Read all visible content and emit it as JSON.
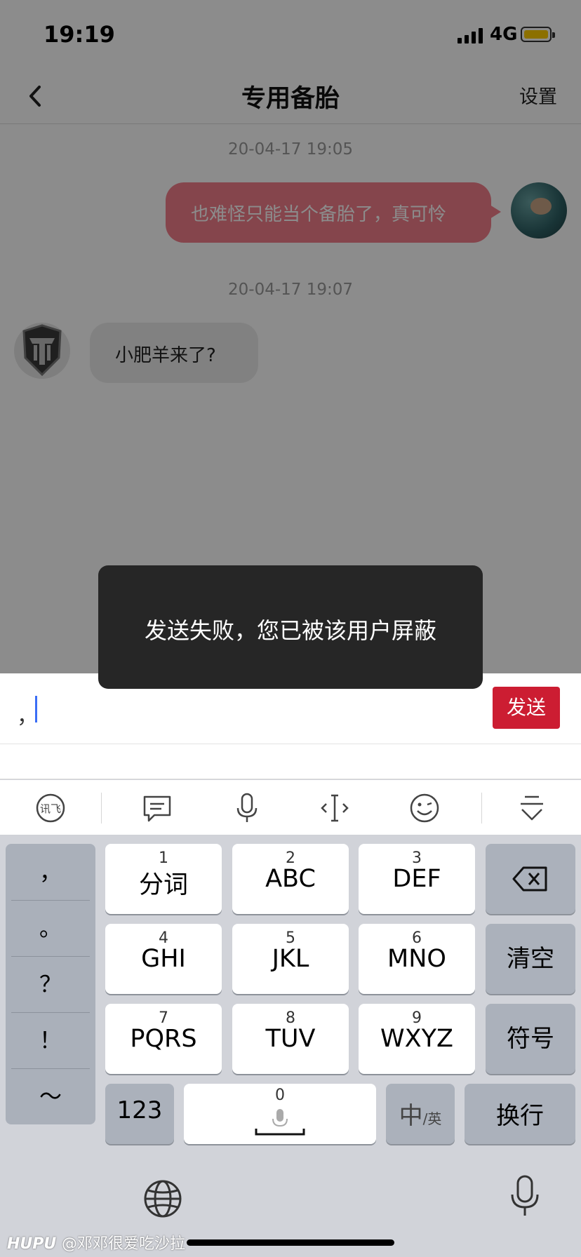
{
  "status_bar": {
    "time": "19:19",
    "network": "4G",
    "battery_color": "#ffcc00"
  },
  "nav": {
    "title": "专用备胎",
    "settings_label": "设置"
  },
  "messages": [
    {
      "timestamp": "20-04-17 19:05",
      "direction": "out",
      "text": "也难怪只能当个备胎了，真可怜"
    },
    {
      "timestamp": "20-04-17 19:07",
      "direction": "in",
      "text": "小肥羊来了?"
    }
  ],
  "toast": {
    "text": "发送失败，您已被该用户屏蔽"
  },
  "input": {
    "value": "，",
    "send_label": "发送",
    "send_color": "#cc1d32"
  },
  "toolbar": {
    "icons": [
      "ifly-logo-icon",
      "message-icon",
      "microphone-icon",
      "text-cursor-icon",
      "emoji-icon",
      "collapse-keyboard-icon"
    ],
    "ifly_text": "讯飞"
  },
  "keyboard": {
    "punctuation": [
      "，",
      "。",
      "？",
      "！",
      "～"
    ],
    "keys": [
      {
        "num": "1",
        "label": "分词"
      },
      {
        "num": "2",
        "label": "ABC"
      },
      {
        "num": "3",
        "label": "DEF"
      },
      {
        "num": "4",
        "label": "GHI"
      },
      {
        "num": "5",
        "label": "JKL"
      },
      {
        "num": "6",
        "label": "MNO"
      },
      {
        "num": "7",
        "label": "PQRS"
      },
      {
        "num": "8",
        "label": "TUV"
      },
      {
        "num": "9",
        "label": "WXYZ"
      }
    ],
    "clear_label": "清空",
    "symbols_label": "符号",
    "numbers_label": "123",
    "space_num": "0",
    "lang_main": "中",
    "lang_sub": "/英",
    "return_label": "换行"
  },
  "watermark": {
    "brand": "HUPU",
    "handle": "@邓邓很爱吃沙拉"
  }
}
